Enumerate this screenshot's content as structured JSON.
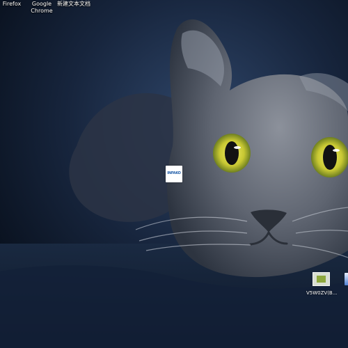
{
  "desktop": {
    "top_icons": [
      {
        "label": "Firefox"
      },
      {
        "label": "Google\nChrome"
      },
      {
        "label": "新建文本文档"
      }
    ],
    "center_file": {
      "thumbnail_text": "INFAKO"
    },
    "bottom_file": {
      "label": "V5W0ZV(B..."
    }
  },
  "colors": {
    "text": "#ffffff",
    "wallpaper_dark": "#0b1424",
    "wallpaper_mid": "#2b3f63",
    "cat_fur": "#6e7481",
    "eye_yellow": "#e5e14b"
  }
}
